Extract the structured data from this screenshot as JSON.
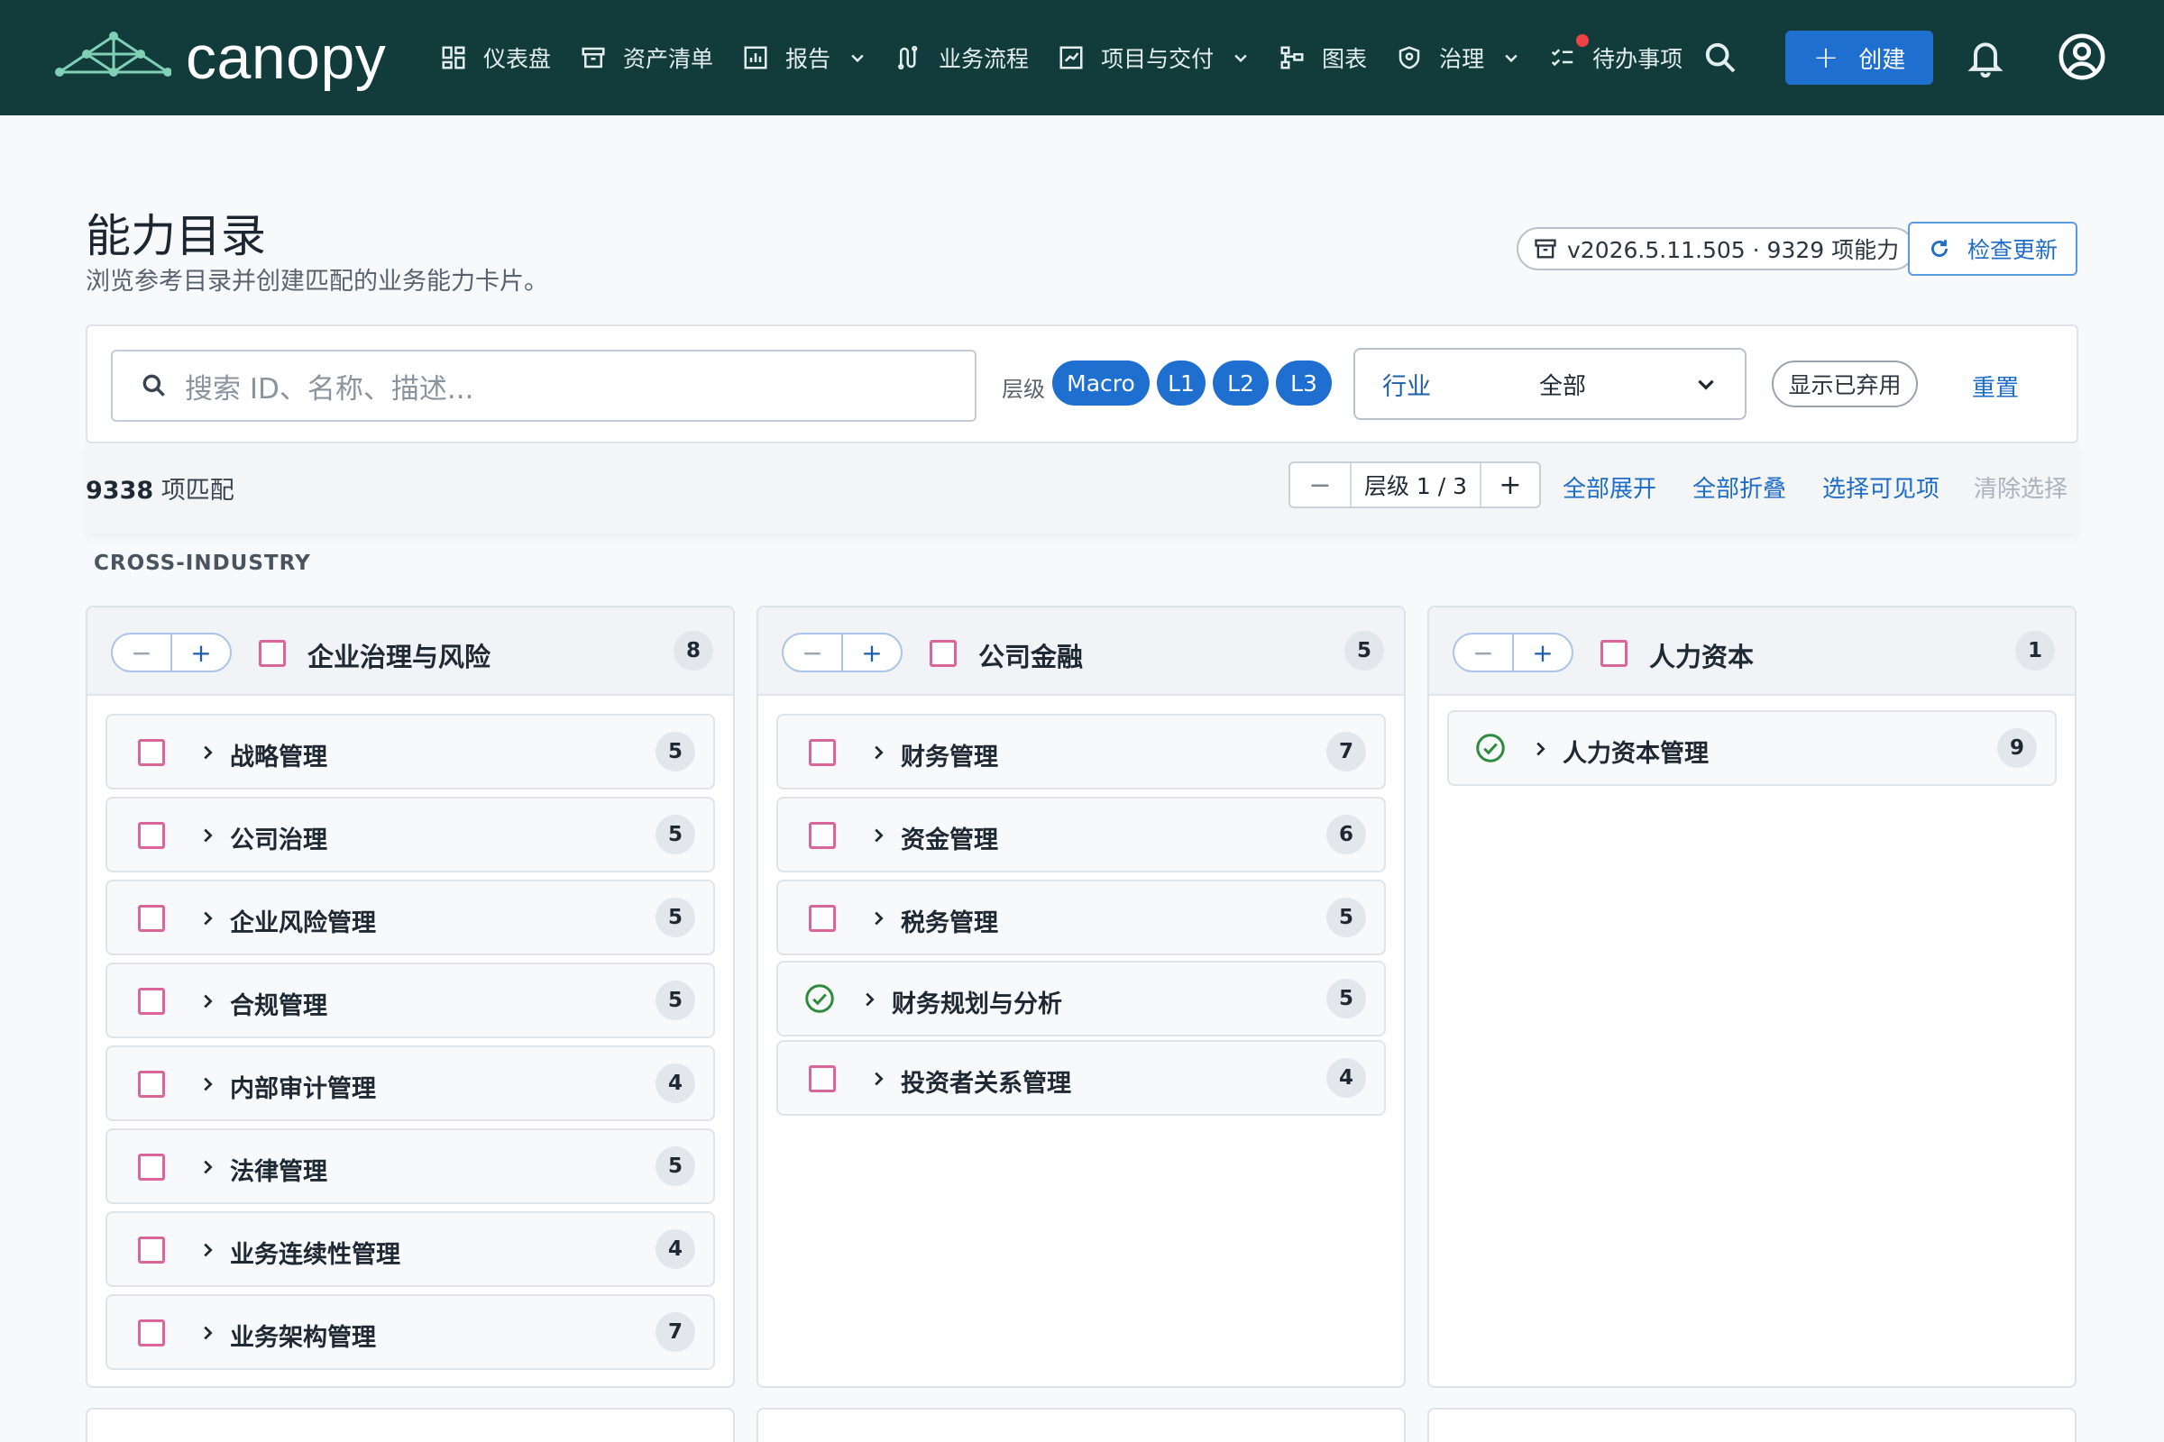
{
  "brand": {
    "name": "canopy",
    "logo_icon": "network-logo-icon"
  },
  "nav": {
    "items": [
      {
        "label": "仪表盘",
        "icon": "dashboard-icon"
      },
      {
        "label": "资产清单",
        "icon": "archive-icon"
      },
      {
        "label": "报告",
        "icon": "report-chart-icon",
        "has_dropdown": true
      },
      {
        "label": "业务流程",
        "icon": "workflow-icon"
      },
      {
        "label": "项目与交付",
        "icon": "project-icon",
        "has_dropdown": true
      },
      {
        "label": "图表",
        "icon": "diagram-icon"
      },
      {
        "label": "治理",
        "icon": "shield-icon",
        "has_dropdown": true
      },
      {
        "label": "待办事项",
        "icon": "checklist-icon",
        "notification_dot": true
      }
    ],
    "create_label": "创建"
  },
  "header": {
    "title": "能力目录",
    "subtitle": "浏览参考目录并创建匹配的业务能力卡片。",
    "version": "v2026.5.11.505 · 9329 项能力",
    "check_update": "检查更新"
  },
  "filters": {
    "search_placeholder": "搜索 ID、名称、描述...",
    "level_label": "层级",
    "levels": [
      "Macro",
      "L1",
      "L2",
      "L3"
    ],
    "industry_label": "行业",
    "industry_value": "全部",
    "show_deprecated": "显示已弃用",
    "reset": "重置"
  },
  "toolbar": {
    "match_number": "9338",
    "match_suffix": " 项匹配",
    "level_stepper": "层级 1 / 3",
    "expand_all": "全部展开",
    "collapse_all": "全部折叠",
    "select_visible": "选择可见项",
    "clear_selection": "清除选择"
  },
  "section": {
    "label": "CROSS-INDUSTRY"
  },
  "cards": [
    {
      "title": "企业治理与风险",
      "count": "8",
      "items": [
        {
          "label": "战略管理",
          "count": "5",
          "selected": false
        },
        {
          "label": "公司治理",
          "count": "5",
          "selected": false
        },
        {
          "label": "企业风险管理",
          "count": "5",
          "selected": false
        },
        {
          "label": "合规管理",
          "count": "5",
          "selected": false
        },
        {
          "label": "内部审计管理",
          "count": "4",
          "selected": false
        },
        {
          "label": "法律管理",
          "count": "5",
          "selected": false
        },
        {
          "label": "业务连续性管理",
          "count": "4",
          "selected": false
        },
        {
          "label": "业务架构管理",
          "count": "7",
          "selected": false
        }
      ]
    },
    {
      "title": "公司金融",
      "count": "5",
      "items": [
        {
          "label": "财务管理",
          "count": "7",
          "selected": false
        },
        {
          "label": "资金管理",
          "count": "6",
          "selected": false
        },
        {
          "label": "税务管理",
          "count": "5",
          "selected": false
        },
        {
          "label": "财务规划与分析",
          "count": "5",
          "selected": true
        },
        {
          "label": "投资者关系管理",
          "count": "4",
          "selected": false
        }
      ]
    },
    {
      "title": "人力资本",
      "count": "1",
      "items": [
        {
          "label": "人力资本管理",
          "count": "9",
          "selected": true
        }
      ]
    }
  ],
  "colors": {
    "topbar": "#123c3c",
    "accent": "#1f6fd1",
    "link": "#1e6cc8",
    "checkbox": "#d9659b",
    "success": "#2e8b3e"
  }
}
